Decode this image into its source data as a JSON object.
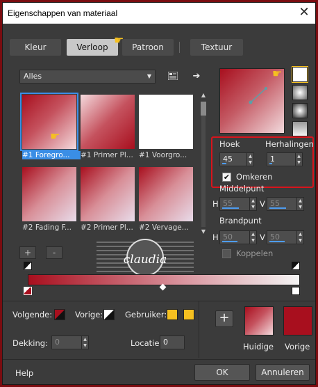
{
  "window": {
    "title": "Eigenschappen van materiaal",
    "close_glyph": "✕"
  },
  "tabs": [
    {
      "label": "Kleur",
      "active": false
    },
    {
      "label": "Verloop",
      "active": true
    },
    {
      "label": "Patroon",
      "active": false
    },
    {
      "label": "Textuur",
      "active": false
    }
  ],
  "category": {
    "selected": "Alles"
  },
  "thumbnails": [
    {
      "label": "#1 Foregro...",
      "selected": true,
      "style": "fg"
    },
    {
      "label": "#1 Primer Pl...",
      "selected": false,
      "style": "primer"
    },
    {
      "label": "#1 Voorgro...",
      "selected": false,
      "style": "white"
    },
    {
      "label": "#2 Fading F...",
      "selected": false,
      "style": "fade"
    },
    {
      "label": "#2 Primer Pl...",
      "selected": false,
      "style": "fade2"
    },
    {
      "label": "#2 Vervage...",
      "selected": false,
      "style": "fade3"
    }
  ],
  "gradient_controls": {
    "angle_label": "Hoek",
    "angle_value": "45",
    "repeats_label": "Herhalingen",
    "repeats_value": "1",
    "invert_label": "Omkeren",
    "invert_checked": true,
    "midpoint_label": "Middelpunt",
    "midpoint_h_label": "H",
    "midpoint_h_value": "55",
    "midpoint_v_label": "V",
    "midpoint_v_value": "55",
    "focal_label": "Brandpunt",
    "focal_h_label": "H",
    "focal_h_value": "50",
    "focal_v_label": "V",
    "focal_v_value": "50",
    "link_label": "Koppelen",
    "link_checked": false
  },
  "editor_buttons": {
    "add": "+",
    "remove": "-"
  },
  "bottom": {
    "next_label": "Volgende:",
    "prev_label": "Vorige:",
    "user_label": "Gebruiker:",
    "opacity_label": "Dekking:",
    "opacity_value": "0",
    "location_label": "Locatie:",
    "location_value": "0",
    "add_button": "+",
    "current_label": "Huidige",
    "previous_label": "Vorige"
  },
  "colors": {
    "red": "#a80f1e",
    "user_yellow": "#f5c020",
    "accent_blue": "#3a8ee6",
    "dialog_bg": "#3b3b3b"
  },
  "footer": {
    "help": "Help",
    "ok": "OK",
    "cancel": "Annuleren"
  },
  "watermark": {
    "text": "claudia"
  }
}
